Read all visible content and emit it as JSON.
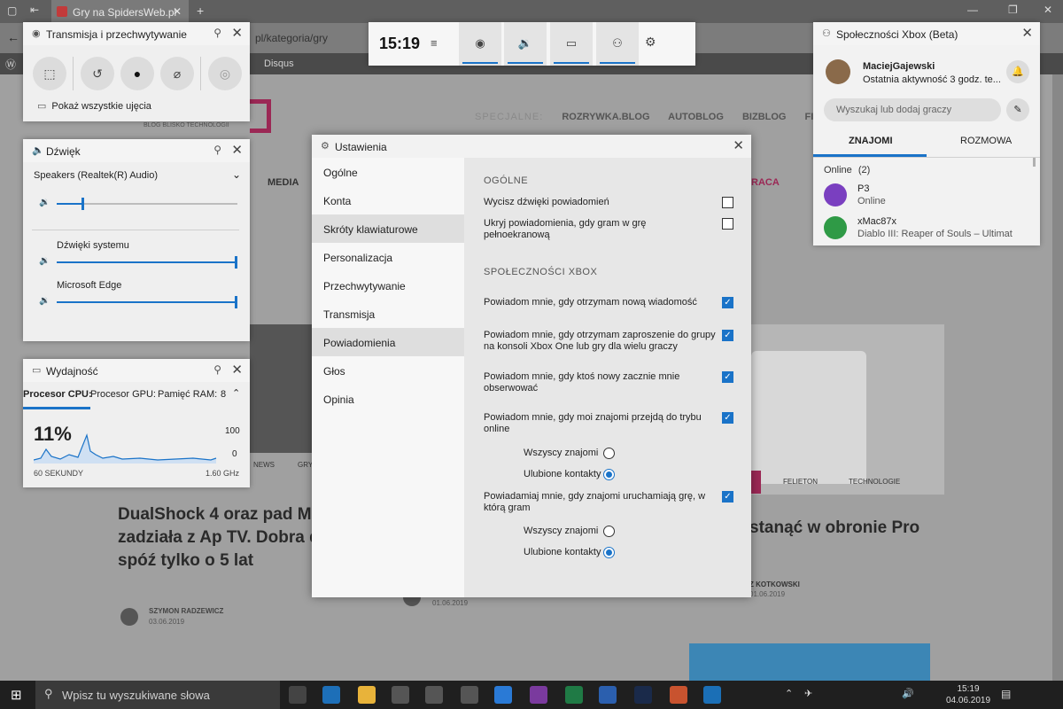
{
  "browser": {
    "tab_title": "Gry na SpidersWeb.pl",
    "url_fragment": "pl/kategoria/gry",
    "site_bar_item": "Disqus"
  },
  "site": {
    "special_label": "SPECJALNE:",
    "nav_links": [
      "ROZRYWKA.BLOG",
      "AUTOBLOG",
      "BIZBLOG",
      "FINTECH"
    ],
    "logo_tagline": "BLOG BLISKO TECHNOLOGII",
    "menu_media": "MEDIA",
    "menu_praca": "RACA",
    "tag_news": "NEWS",
    "tag_gry": "GRY",
    "tag_felieton": "FELIETON",
    "tag_technologie": "TECHNOLOGIE",
    "article_headline": "DualShock 4 oraz pad Microsoftu zadziała z Ap TV. Dobra decyzja, spóź tylko o 5 lat",
    "article_author": "SZYMON RADZEWICZ",
    "article_date": "03.06.2019",
    "mid_date": "01.06.2019",
    "side_headline": "stanąć w obronie Pro",
    "side_author": "Z KOTKOWSKI",
    "side_date": "01.06.2019"
  },
  "capture_panel": {
    "title": "Transmisja i przechwytywanie",
    "show_all_label": "Pokaż wszystkie ujęcia"
  },
  "audio_panel": {
    "title": "Dźwięk",
    "device": "Speakers (Realtek(R) Audio)",
    "master_level": 0.14,
    "apps": [
      {
        "name": "Dźwięki systemu",
        "level": 1.0
      },
      {
        "name": "Microsoft Edge",
        "level": 1.0
      }
    ]
  },
  "perf_panel": {
    "title": "Wydajność",
    "tabs": [
      "Procesor CPU:",
      "Procesor GPU:",
      "Pamięć RAM:",
      "8"
    ],
    "cpu_value": "11%",
    "axis_max": "100",
    "axis_min": "0",
    "duration": "60 SEKUNDY",
    "frequency": "1.60 GHz"
  },
  "xbox_bar": {
    "time": "15:19"
  },
  "settings": {
    "title": "Ustawienia",
    "nav": [
      "Ogólne",
      "Konta",
      "Skróty klawiaturowe",
      "Personalizacja",
      "Przechwytywanie",
      "Transmisja",
      "Powiadomienia",
      "Głos",
      "Opinia"
    ],
    "selected_nav": "Powiadomienia",
    "section_general": "OGÓLNE",
    "general_options": [
      {
        "label": "Wycisz dźwięki powiadomień",
        "checked": false
      },
      {
        "label": "Ukryj powiadomienia, gdy gram w grę pełnoekranową",
        "checked": false
      }
    ],
    "section_xbox": "SPOŁECZNOŚCI XBOX",
    "xbox_options": [
      {
        "label": "Powiadom mnie, gdy otrzymam nową wiadomość",
        "checked": true
      },
      {
        "label": "Powiadom mnie, gdy otrzymam zaproszenie do grupy na konsoli Xbox One lub gry dla wielu graczy",
        "checked": true
      },
      {
        "label": "Powiadom mnie, gdy ktoś nowy zacznie mnie obserwować",
        "checked": true
      },
      {
        "label": "Powiadom mnie, gdy moi znajomi przejdą do trybu online",
        "checked": true
      },
      {
        "label": "Powiadamiaj mnie, gdy znajomi uruchamiają grę, w którą gram",
        "checked": true
      }
    ],
    "radio_group_1": [
      {
        "label": "Wszyscy znajomi",
        "selected": false
      },
      {
        "label": "Ulubione kontakty",
        "selected": true
      }
    ],
    "radio_group_2": [
      {
        "label": "Wszyscy znajomi",
        "selected": false
      },
      {
        "label": "Ulubione kontakty",
        "selected": true
      }
    ]
  },
  "social": {
    "title": "Społeczności Xbox (Beta)",
    "user_name": "MaciejGajewski",
    "user_status": "Ostatnia aktywność 3 godz. te...",
    "search_placeholder": "Wyszukaj lub dodaj graczy",
    "tab_friends": "ZNAJOMI",
    "tab_chat": "ROZMOWA",
    "online_header": "Online",
    "online_count": "(2)",
    "friends": [
      {
        "name": "P3",
        "status": "Online"
      },
      {
        "name": "xMac87x",
        "status": "Diablo III: Reaper of Souls – Ultimat"
      }
    ]
  },
  "taskbar": {
    "search_placeholder": "Wpisz tu wyszukiwane słowa",
    "time": "15:19",
    "date": "04.06.2019"
  },
  "colors": {
    "accent": "#1a73c8",
    "brand": "#9b2855"
  }
}
